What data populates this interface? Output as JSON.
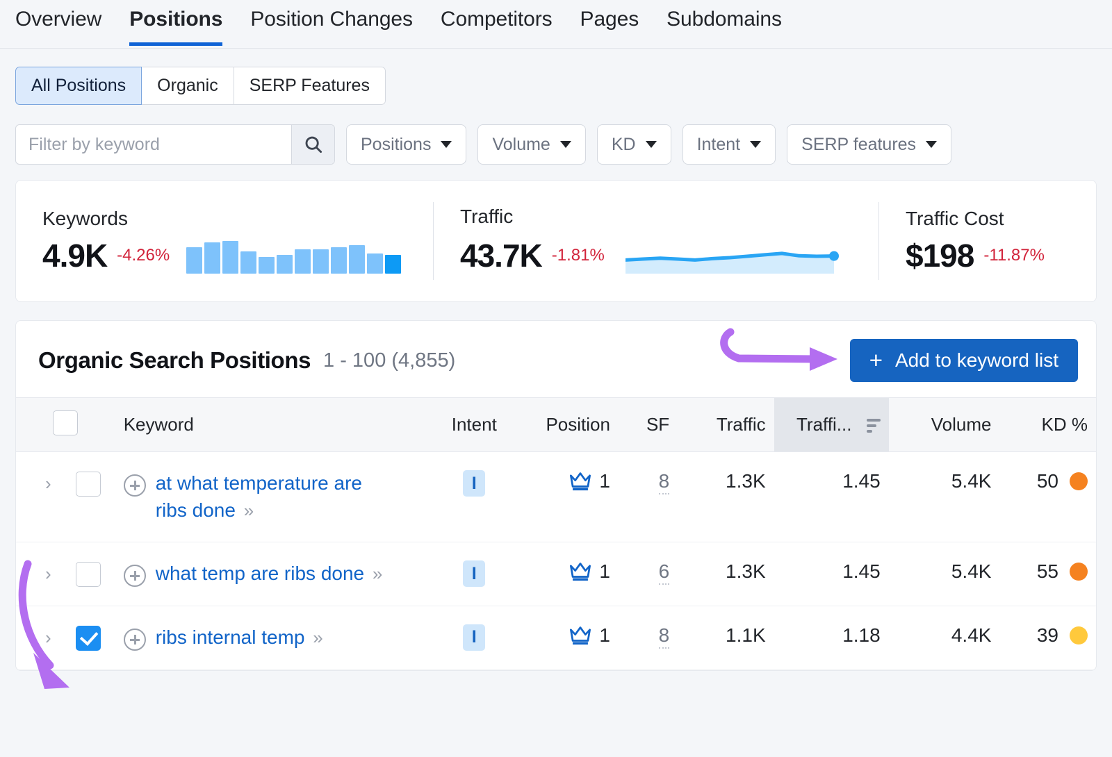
{
  "nav": {
    "tabs": [
      {
        "label": "Overview",
        "active": false
      },
      {
        "label": "Positions",
        "active": true
      },
      {
        "label": "Position Changes",
        "active": false
      },
      {
        "label": "Competitors",
        "active": false
      },
      {
        "label": "Pages",
        "active": false
      },
      {
        "label": "Subdomains",
        "active": false
      }
    ]
  },
  "toolbar": {
    "segments": [
      {
        "label": "All Positions",
        "active": true
      },
      {
        "label": "Organic",
        "active": false
      },
      {
        "label": "SERP Features",
        "active": false
      }
    ],
    "search": {
      "placeholder": "Filter by keyword",
      "value": "",
      "icon": "search-icon"
    },
    "dropdowns": [
      {
        "label": "Positions"
      },
      {
        "label": "Volume"
      },
      {
        "label": "KD"
      },
      {
        "label": "Intent"
      },
      {
        "label": "SERP features"
      }
    ]
  },
  "metrics": [
    {
      "label": "Keywords",
      "value": "4.9K",
      "delta": "-4.26%",
      "chart": "bars"
    },
    {
      "label": "Traffic",
      "value": "43.7K",
      "delta": "-1.81%",
      "chart": "area"
    },
    {
      "label": "Traffic Cost",
      "value": "$198",
      "delta": "-11.87%",
      "chart": "none"
    }
  ],
  "panel": {
    "title": "Organic Search Positions",
    "range": "1 - 100 (4,855)",
    "add_button": {
      "label": "Add to keyword list",
      "plus": "+"
    }
  },
  "table": {
    "columns": [
      {
        "key": "check",
        "label": ""
      },
      {
        "key": "keyword",
        "label": "Keyword"
      },
      {
        "key": "intent",
        "label": "Intent"
      },
      {
        "key": "position",
        "label": "Position"
      },
      {
        "key": "sf",
        "label": "SF"
      },
      {
        "key": "traffic",
        "label": "Traffic"
      },
      {
        "key": "traffic_pct",
        "label": "Traffi...",
        "sorted": true
      },
      {
        "key": "volume",
        "label": "Volume"
      },
      {
        "key": "kd",
        "label": "KD %"
      }
    ],
    "rows": [
      {
        "keyword": "at what temperature are ribs done",
        "intent": "I",
        "position": "1",
        "position_icon": "crown-icon",
        "sf": "8",
        "traffic": "1.3K",
        "traffic_pct": "1.45",
        "volume": "5.4K",
        "kd": "50",
        "kd_color": "#F58220",
        "checked": false
      },
      {
        "keyword": "what temp are ribs done",
        "intent": "I",
        "position": "1",
        "position_icon": "crown-icon",
        "sf": "6",
        "traffic": "1.3K",
        "traffic_pct": "1.45",
        "volume": "5.4K",
        "kd": "55",
        "kd_color": "#F58220",
        "checked": false
      },
      {
        "keyword": "ribs internal temp",
        "intent": "I",
        "position": "1",
        "position_icon": "crown-icon",
        "sf": "8",
        "traffic": "1.1K",
        "traffic_pct": "1.18",
        "volume": "4.4K",
        "kd": "39",
        "kd_color": "#FFC93C",
        "checked": true
      }
    ]
  },
  "colors": {
    "accent_blue": "#1664c0",
    "link_blue": "#1164c8",
    "negative_red": "#d2243b",
    "annotation_purple": "#b36ef0",
    "sparkline_blue": "#29a5f4",
    "bar_blue": "#7ec2fb"
  },
  "chart_data": [
    {
      "type": "bar",
      "title": "Keywords",
      "categories": [
        "1",
        "2",
        "3",
        "4",
        "5",
        "6",
        "7",
        "8",
        "9",
        "10",
        "11",
        "12"
      ],
      "values": [
        74,
        86,
        90,
        62,
        46,
        52,
        68,
        68,
        74,
        78,
        56,
        52
      ],
      "ylim": [
        0,
        100
      ],
      "xlabel": "",
      "ylabel": "",
      "grid": false,
      "legend": false
    },
    {
      "type": "area",
      "title": "Traffic",
      "x": [
        0,
        1,
        2,
        3,
        4,
        5,
        6,
        7,
        8,
        9,
        10,
        11,
        12
      ],
      "values": [
        40,
        44,
        48,
        44,
        40,
        46,
        50,
        56,
        62,
        68,
        58,
        56,
        57
      ],
      "ylim": [
        0,
        100
      ],
      "xlabel": "",
      "ylabel": "",
      "grid": false,
      "legend": false,
      "end_marker": true
    }
  ],
  "annotations": [
    {
      "name": "arrow-to-add-button",
      "color": "#b36ef0",
      "target": "add-to-keyword-list-button"
    },
    {
      "name": "arrow-to-row-checkbox",
      "color": "#b36ef0",
      "target": "row-checkbox-3"
    }
  ]
}
